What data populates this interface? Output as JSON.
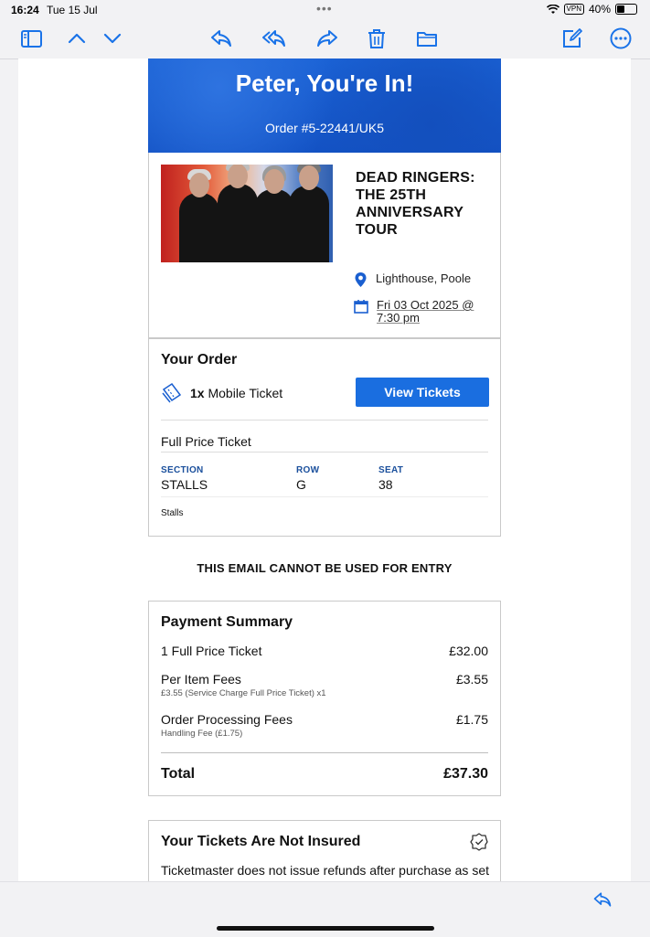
{
  "status_bar": {
    "time": "16:24",
    "date": "Tue 15 Jul",
    "vpn": "VPN",
    "battery": "40%",
    "battery_level": 0.4
  },
  "toolbar": {
    "icons": [
      "sidebar-icon",
      "chevron-up-icon",
      "chevron-down-icon",
      "reply-icon",
      "reply-all-icon",
      "forward-icon",
      "trash-icon",
      "folder-icon",
      "compose-icon",
      "more-icon"
    ],
    "accent": "#1a73e8"
  },
  "hero": {
    "title": "Peter, You're In!",
    "order": "Order #5-22441/UK5",
    "color": "#1a5fd0"
  },
  "event": {
    "title": "DEAD RINGERS: THE 25TH ANNIVERSARY TOUR",
    "venue": "Lighthouse, Poole",
    "datetime": "Fri 03 Oct 2025 @ 7:30 pm"
  },
  "order": {
    "heading": "Your Order",
    "qty": "1x",
    "ticket_type": "Mobile Ticket",
    "view_button": "View Tickets",
    "price_type": "Full Price Ticket",
    "section_label": "SECTION",
    "section": "STALLS",
    "row_label": "ROW",
    "row": "G",
    "seat_label": "SEAT",
    "seat": "38",
    "note": "Stalls"
  },
  "notice": "THIS EMAIL CANNOT BE USED FOR ENTRY",
  "payment": {
    "heading": "Payment Summary",
    "items": [
      {
        "label": "1 Full Price Ticket",
        "amount": "£32.00",
        "sub": ""
      },
      {
        "label": "Per Item Fees",
        "amount": "£3.55",
        "sub": "£3.55 (Service Charge Full Price Ticket) x1"
      },
      {
        "label": "Order Processing Fees",
        "amount": "£1.75",
        "sub": "Handling Fee (£1.75)"
      }
    ],
    "total_label": "Total",
    "total": "£37.30"
  },
  "insurance": {
    "heading": "Your Tickets Are Not Insured",
    "text": "Ticketmaster does not issue refunds after purchase as set"
  }
}
